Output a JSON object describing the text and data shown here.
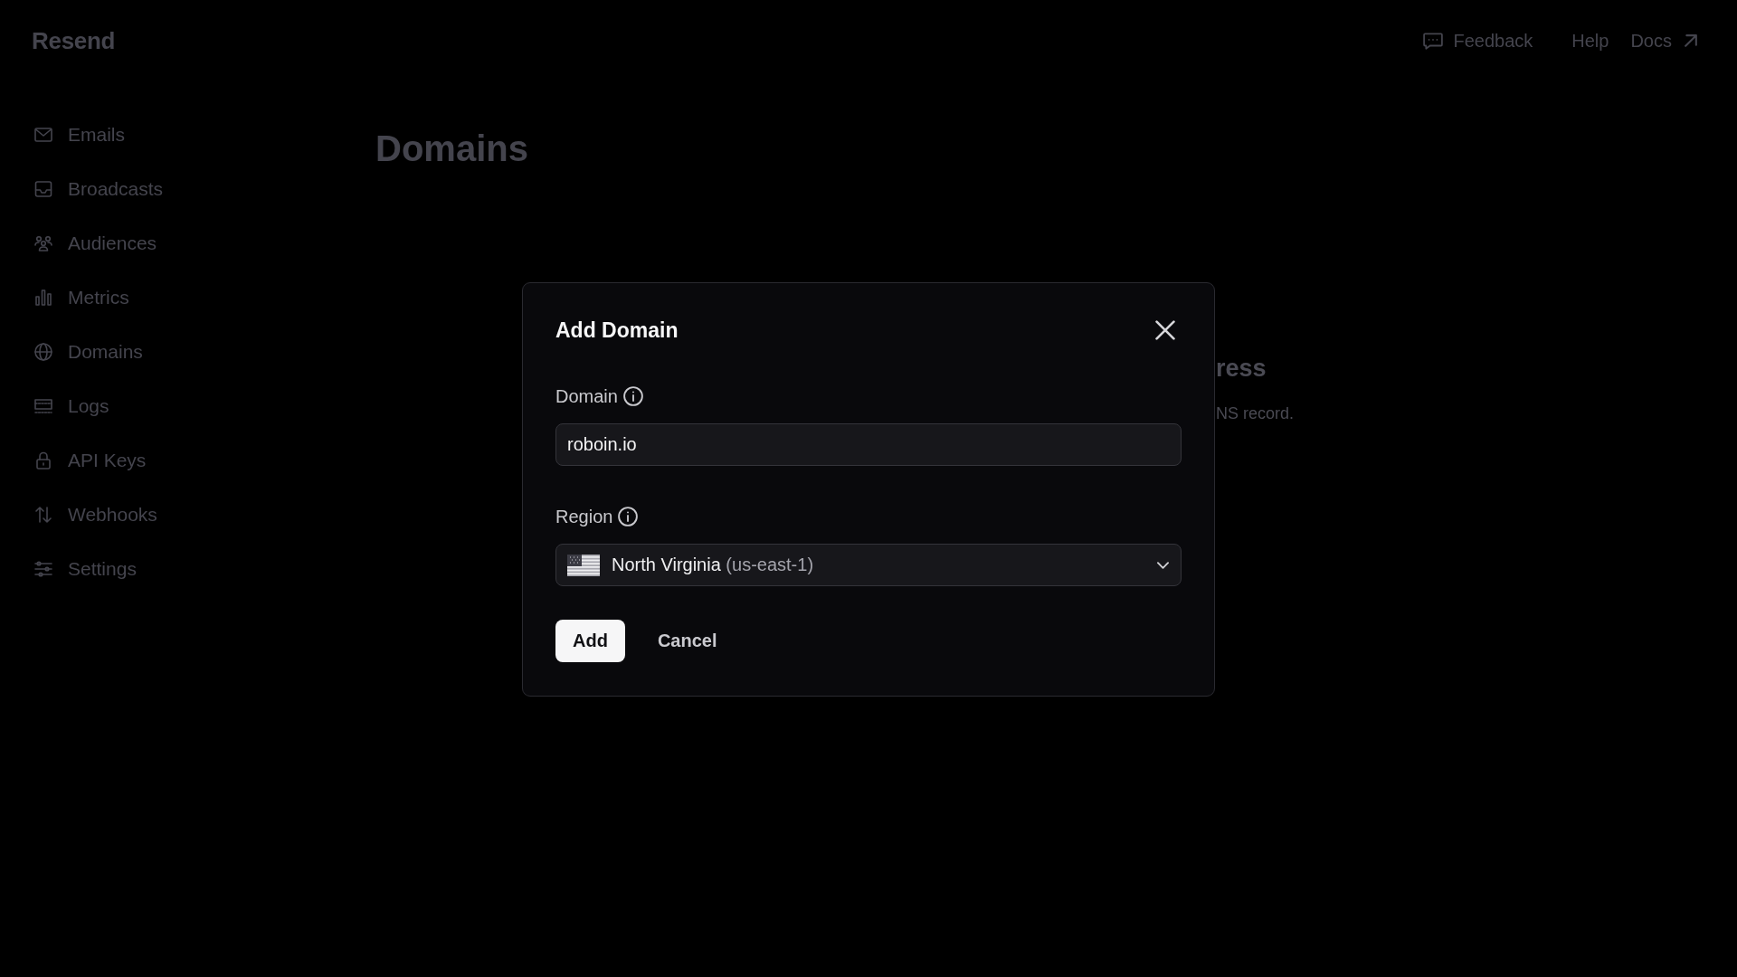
{
  "header": {
    "logo": "Resend",
    "links": [
      {
        "label": "Feedback",
        "kind": "feedback"
      },
      {
        "label": "Help",
        "kind": "plain"
      },
      {
        "label": "Docs",
        "kind": "external"
      }
    ]
  },
  "sidebar": {
    "items": [
      {
        "label": "Emails"
      },
      {
        "label": "Broadcasts"
      },
      {
        "label": "Audiences"
      },
      {
        "label": "Metrics"
      },
      {
        "label": "Domains"
      },
      {
        "label": "Logs"
      },
      {
        "label": "API Keys"
      },
      {
        "label": "Webhooks"
      },
      {
        "label": "Settings"
      }
    ]
  },
  "main": {
    "title": "Domains",
    "empty_state": {
      "heading": "ress",
      "text": "NS record."
    }
  },
  "dialog": {
    "title": "Add Domain",
    "fields": [
      {
        "label": "Domain",
        "kind": "text",
        "value": "roboin.io"
      },
      {
        "label": "Region",
        "kind": "select",
        "value": "North Virginia",
        "detail": "(us-east-1)"
      }
    ],
    "buttons": [
      {
        "label": "Add",
        "kind": "primary"
      },
      {
        "label": "Cancel",
        "kind": "secondary"
      }
    ]
  }
}
